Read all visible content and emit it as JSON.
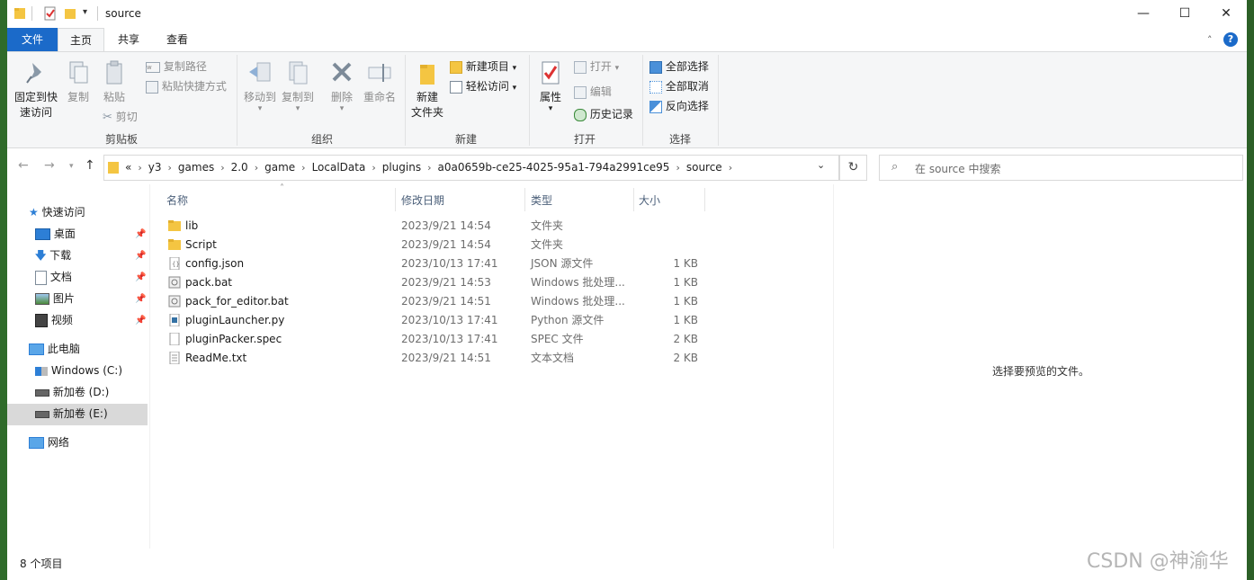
{
  "window": {
    "title": "source"
  },
  "window_buttons": {
    "minimize": "—",
    "maximize": "☐",
    "close": "✕"
  },
  "ribbon_tabs": {
    "file": "文件",
    "home": "主页",
    "share": "共享",
    "view": "查看"
  },
  "ribbon": {
    "clipboard": {
      "label": "剪贴板",
      "pin": "固定到快\n速访问",
      "pin_line1": "固定到快",
      "pin_line2": "速访问",
      "copy": "复制",
      "paste": "粘贴",
      "copy_path": "复制路径",
      "paste_shortcut": "粘贴快捷方式",
      "cut": "剪切"
    },
    "organize": {
      "label": "组织",
      "move_to": "移动到",
      "copy_to": "复制到",
      "delete": "删除",
      "rename": "重命名"
    },
    "new": {
      "label": "新建",
      "new_folder_line1": "新建",
      "new_folder_line2": "文件夹",
      "new_item": "新建项目",
      "easy_access": "轻松访问"
    },
    "open": {
      "label": "打开",
      "properties": "属性",
      "open": "打开",
      "edit": "编辑",
      "history": "历史记录"
    },
    "select": {
      "label": "选择",
      "select_all": "全部选择",
      "select_none": "全部取消",
      "invert": "反向选择"
    }
  },
  "address": {
    "overflow": "«",
    "crumbs": [
      "y3",
      "games",
      "2.0",
      "game",
      "LocalData",
      "plugins",
      "a0a0659b-ce25-4025-95a1-794a2991ce95",
      "source"
    ]
  },
  "search": {
    "placeholder": "在 source 中搜索"
  },
  "nav": {
    "quick_access": "快速访问",
    "desktop": "桌面",
    "downloads": "下载",
    "documents": "文档",
    "pictures": "图片",
    "videos": "视频",
    "this_pc": "此电脑",
    "drive_c": "Windows (C:)",
    "drive_d": "新加卷 (D:)",
    "drive_e": "新加卷 (E:)",
    "network": "网络"
  },
  "columns": {
    "name": "名称",
    "date": "修改日期",
    "type": "类型",
    "size": "大小"
  },
  "files": [
    {
      "name": "lib",
      "date": "2023/9/21 14:54",
      "type": "文件夹",
      "size": "",
      "icon": "folder"
    },
    {
      "name": "Script",
      "date": "2023/9/21 14:54",
      "type": "文件夹",
      "size": "",
      "icon": "folder"
    },
    {
      "name": "config.json",
      "date": "2023/10/13 17:41",
      "type": "JSON 源文件",
      "size": "1 KB",
      "icon": "json"
    },
    {
      "name": "pack.bat",
      "date": "2023/9/21 14:53",
      "type": "Windows 批处理...",
      "size": "1 KB",
      "icon": "bat"
    },
    {
      "name": "pack_for_editor.bat",
      "date": "2023/9/21 14:51",
      "type": "Windows 批处理...",
      "size": "1 KB",
      "icon": "bat"
    },
    {
      "name": "pluginLauncher.py",
      "date": "2023/10/13 17:41",
      "type": "Python 源文件",
      "size": "1 KB",
      "icon": "py"
    },
    {
      "name": "pluginPacker.spec",
      "date": "2023/10/13 17:41",
      "type": "SPEC 文件",
      "size": "2 KB",
      "icon": "file"
    },
    {
      "name": "ReadMe.txt",
      "date": "2023/9/21 14:51",
      "type": "文本文档",
      "size": "2 KB",
      "icon": "txt"
    }
  ],
  "preview": {
    "message": "选择要预览的文件。"
  },
  "status": {
    "count": "8 个项目"
  },
  "watermark": "CSDN @神渝华",
  "colors": {
    "accent": "#1b6ac9",
    "folder": "#f4c542",
    "selected": "#d9d9d9"
  }
}
